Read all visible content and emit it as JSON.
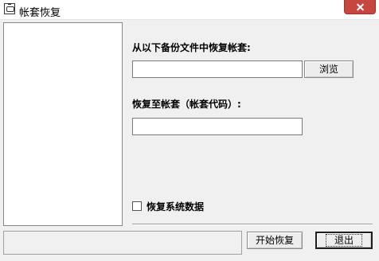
{
  "window": {
    "title": "帐套恢复",
    "icon": "restore-app-icon"
  },
  "form": {
    "source_label": "从以下备份文件中恢复帐套:",
    "source_value": "",
    "browse_label": "浏览",
    "target_label": "恢复至帐套（帐套代码）:",
    "target_value": "",
    "checkbox_label": "恢复系统数据",
    "checkbox_checked": false
  },
  "footer": {
    "start_label": "开始恢复",
    "exit_label": "退出"
  }
}
